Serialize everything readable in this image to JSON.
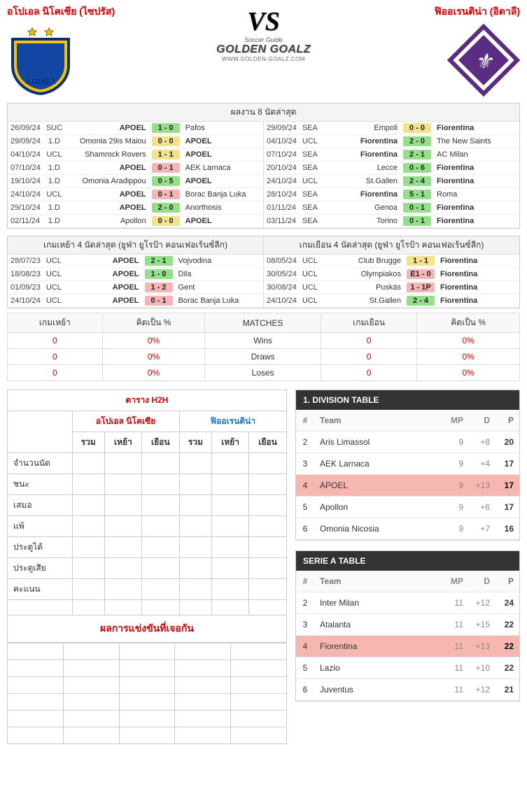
{
  "header": {
    "home_name": "อโปเอล นิโคเซีย (ไซปรัส)",
    "away_name": "ฟิออเรนติน่า (อิตาลี)",
    "vs": "VS",
    "brand_top": "Soccer Guide",
    "brand_main": "GOLDEN GOALZ",
    "brand_url": "WWW.GOLDEN-GOALZ.COM"
  },
  "section_last8_title": "ผลงาน 8 นัดล่าสุด",
  "last8_home": [
    {
      "date": "26/09/24",
      "comp": "SUC",
      "home": "APOEL",
      "home_b": true,
      "score": "1 - 0",
      "cls": "sc-win",
      "away": "Pafos",
      "away_b": false
    },
    {
      "date": "29/09/24",
      "comp": "1.D",
      "home": "Omonia 29is Maiou",
      "home_b": false,
      "score": "0 - 0",
      "cls": "sc-draw",
      "away": "APOEL",
      "away_b": true
    },
    {
      "date": "04/10/24",
      "comp": "UCL",
      "home": "Shamrock Rovers",
      "home_b": false,
      "score": "1 - 1",
      "cls": "sc-draw",
      "away": "APOEL",
      "away_b": true
    },
    {
      "date": "07/10/24",
      "comp": "1.D",
      "home": "APOEL",
      "home_b": true,
      "score": "0 - 1",
      "cls": "sc-loss",
      "away": "AEK Larnaca",
      "away_b": false
    },
    {
      "date": "19/10/24",
      "comp": "1.D",
      "home": "Omonia Aradippou",
      "home_b": false,
      "score": "0 - 5",
      "cls": "sc-win",
      "away": "APOEL",
      "away_b": true
    },
    {
      "date": "24/10/24",
      "comp": "UCL",
      "home": "APOEL",
      "home_b": true,
      "score": "0 - 1",
      "cls": "sc-loss",
      "away": "Borac Banja Luka",
      "away_b": false
    },
    {
      "date": "29/10/24",
      "comp": "1.D",
      "home": "APOEL",
      "home_b": true,
      "score": "2 - 0",
      "cls": "sc-win",
      "away": "Anorthosis",
      "away_b": false
    },
    {
      "date": "02/11/24",
      "comp": "1.D",
      "home": "Apollon",
      "home_b": false,
      "score": "0 - 0",
      "cls": "sc-draw",
      "away": "APOEL",
      "away_b": true
    }
  ],
  "last8_away": [
    {
      "date": "29/09/24",
      "comp": "SEA",
      "home": "Empoli",
      "home_b": false,
      "score": "0 - 0",
      "cls": "sc-draw",
      "away": "Fiorentina",
      "away_b": true
    },
    {
      "date": "04/10/24",
      "comp": "UCL",
      "home": "Fiorentina",
      "home_b": true,
      "score": "2 - 0",
      "cls": "sc-win",
      "away": "The New Saints",
      "away_b": false
    },
    {
      "date": "07/10/24",
      "comp": "SEA",
      "home": "Fiorentina",
      "home_b": true,
      "score": "2 - 1",
      "cls": "sc-win",
      "away": "AC Milan",
      "away_b": false
    },
    {
      "date": "20/10/24",
      "comp": "SEA",
      "home": "Lecce",
      "home_b": false,
      "score": "0 - 6",
      "cls": "sc-win",
      "away": "Fiorentina",
      "away_b": true
    },
    {
      "date": "24/10/24",
      "comp": "UCL",
      "home": "St.Gallen",
      "home_b": false,
      "score": "2 - 4",
      "cls": "sc-win",
      "away": "Fiorentina",
      "away_b": true
    },
    {
      "date": "28/10/24",
      "comp": "SEA",
      "home": "Fiorentina",
      "home_b": true,
      "score": "5 - 1",
      "cls": "sc-win",
      "away": "Roma",
      "away_b": false
    },
    {
      "date": "01/11/24",
      "comp": "SEA",
      "home": "Genoa",
      "home_b": false,
      "score": "0 - 1",
      "cls": "sc-win",
      "away": "Fiorentina",
      "away_b": true
    },
    {
      "date": "03/11/24",
      "comp": "SEA",
      "home": "Torino",
      "home_b": false,
      "score": "0 - 1",
      "cls": "sc-win",
      "away": "Fiorentina",
      "away_b": true
    }
  ],
  "section_last4_home_title": "เกมเหย้า 4 นัดล่าสุด (ยูฟ่า ยูโรป้า คอนเฟอเร้นซ์ลีก)",
  "section_last4_away_title": "เกมเยือน 4 นัดล่าสุด (ยูฟ่า ยูโรป้า คอนเฟอเร้นซ์ลีก)",
  "last4_home": [
    {
      "date": "28/07/23",
      "comp": "UCL",
      "home": "APOEL",
      "home_b": true,
      "score": "2 - 1",
      "cls": "sc-win",
      "away": "Vojvodina",
      "away_b": false
    },
    {
      "date": "18/08/23",
      "comp": "UCL",
      "home": "APOEL",
      "home_b": true,
      "score": "1 - 0",
      "cls": "sc-win",
      "away": "Dila",
      "away_b": false
    },
    {
      "date": "01/09/23",
      "comp": "UCL",
      "home": "APOEL",
      "home_b": true,
      "score": "1 - 2",
      "cls": "sc-loss",
      "away": "Gent",
      "away_b": false
    },
    {
      "date": "24/10/24",
      "comp": "UCL",
      "home": "APOEL",
      "home_b": true,
      "score": "0 - 1",
      "cls": "sc-loss",
      "away": "Borac Banja Luka",
      "away_b": false
    }
  ],
  "last4_away": [
    {
      "date": "08/05/24",
      "comp": "UCL",
      "home": "Club Brugge",
      "home_b": false,
      "score": "1 - 1",
      "cls": "sc-draw",
      "away": "Fiorentina",
      "away_b": true
    },
    {
      "date": "30/05/24",
      "comp": "UCL",
      "home": "Olympiakos",
      "home_b": false,
      "score": "E1 - 0",
      "cls": "sc-ext",
      "away": "Fiorentina",
      "away_b": true
    },
    {
      "date": "30/08/24",
      "comp": "UCL",
      "home": "Puskás",
      "home_b": false,
      "score": "1 - 1P",
      "cls": "sc-loss",
      "away": "Fiorentina",
      "away_b": true
    },
    {
      "date": "24/10/24",
      "comp": "UCL",
      "home": "St.Gallen",
      "home_b": false,
      "score": "2 - 4",
      "cls": "sc-win",
      "away": "Fiorentina",
      "away_b": true
    }
  ],
  "stat_headers": {
    "home": "เกมเหย้า",
    "home_pct": "คิดเป็น %",
    "matches": "MATCHES",
    "away": "เกมเยือน",
    "away_pct": "คิดเป็น %"
  },
  "stat_rows": [
    {
      "h": "0",
      "hp": "0%",
      "label": "Wins",
      "a": "0",
      "ap": "0%"
    },
    {
      "h": "0",
      "hp": "0%",
      "label": "Draws",
      "a": "0",
      "ap": "0%"
    },
    {
      "h": "0",
      "hp": "0%",
      "label": "Loses",
      "a": "0",
      "ap": "0%"
    }
  ],
  "h2h": {
    "title": "ตาราง H2H",
    "home_label": "อโปเอล นิโคเซีย",
    "away_label": "ฟิออเรนติน่า",
    "cols": {
      "total": "รวม",
      "home": "เหย้า",
      "away": "เยือน"
    },
    "rows": [
      "จำนวนนัด",
      "ชนะ",
      "เสมอ",
      "แพ้",
      "ประตูได้",
      "ประตูเสีย",
      "คะแนน"
    ]
  },
  "meetings_title": "ผลการแข่งขันที่เจอกัน",
  "standings": [
    {
      "title": "1. DIVISION TABLE",
      "cols": {
        "pos": "#",
        "team": "Team",
        "mp": "MP",
        "d": "D",
        "p": "P"
      },
      "rows": [
        {
          "pos": 2,
          "team": "Aris Limassol",
          "mp": 9,
          "d": "+8",
          "p": 20,
          "hi": false
        },
        {
          "pos": 3,
          "team": "AEK Larnaca",
          "mp": 9,
          "d": "+4",
          "p": 17,
          "hi": false
        },
        {
          "pos": 4,
          "team": "APOEL",
          "mp": 9,
          "d": "+13",
          "p": 17,
          "hi": true
        },
        {
          "pos": 5,
          "team": "Apollon",
          "mp": 9,
          "d": "+6",
          "p": 17,
          "hi": false
        },
        {
          "pos": 6,
          "team": "Omonia Nicosia",
          "mp": 9,
          "d": "+7",
          "p": 16,
          "hi": false
        }
      ]
    },
    {
      "title": "SERIE A TABLE",
      "cols": {
        "pos": "#",
        "team": "Team",
        "mp": "MP",
        "d": "D",
        "p": "P"
      },
      "rows": [
        {
          "pos": 2,
          "team": "Inter Milan",
          "mp": 11,
          "d": "+12",
          "p": 24,
          "hi": false
        },
        {
          "pos": 3,
          "team": "Atalanta",
          "mp": 11,
          "d": "+15",
          "p": 22,
          "hi": false
        },
        {
          "pos": 4,
          "team": "Fiorentina",
          "mp": 11,
          "d": "+13",
          "p": 22,
          "hi": true
        },
        {
          "pos": 5,
          "team": "Lazio",
          "mp": 11,
          "d": "+10",
          "p": 22,
          "hi": false
        },
        {
          "pos": 6,
          "team": "Juventus",
          "mp": 11,
          "d": "+12",
          "p": 21,
          "hi": false
        }
      ]
    }
  ]
}
